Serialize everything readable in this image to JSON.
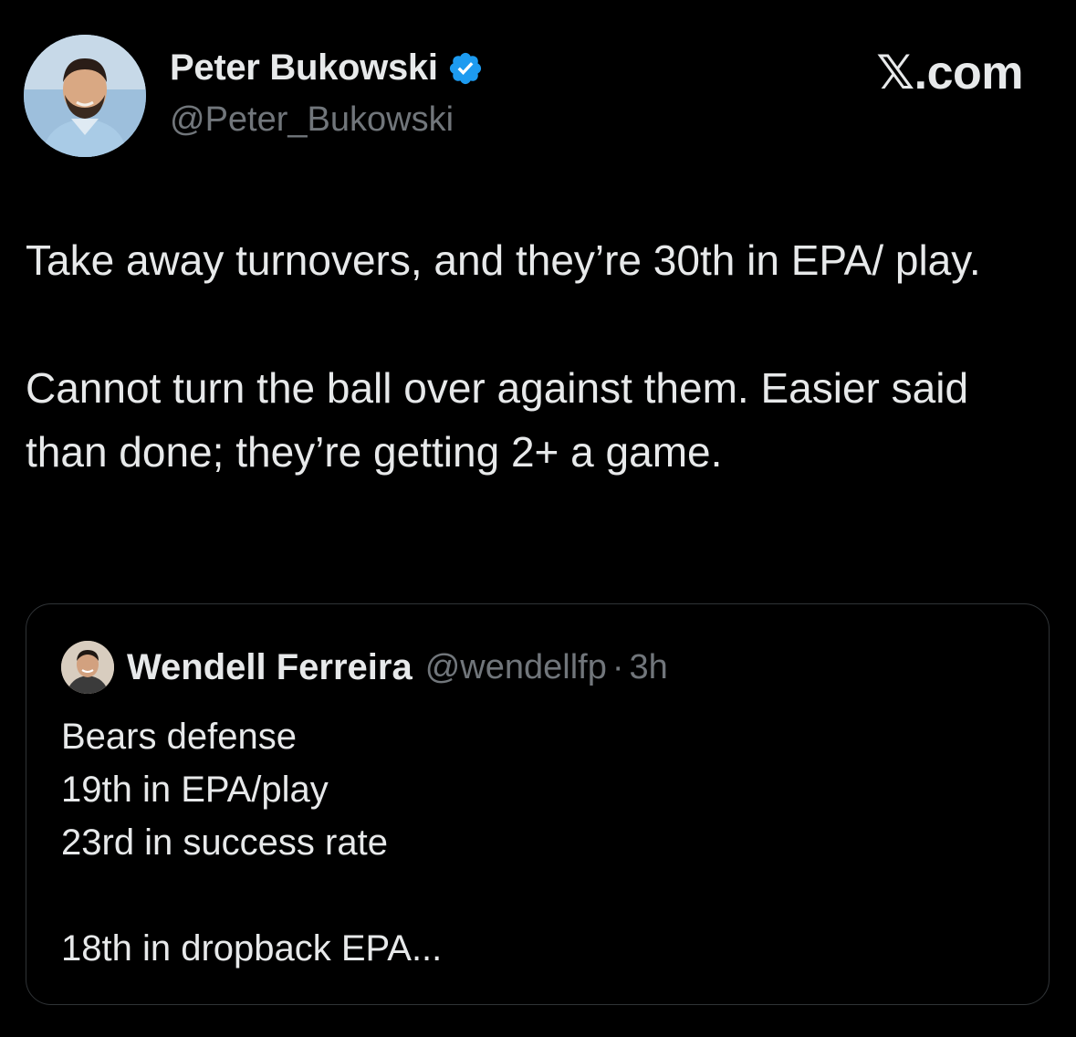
{
  "author": {
    "display_name": "Peter Bukowski",
    "handle": "@Peter_Bukowski",
    "verified_icon": "verified-badge-icon",
    "verified_color": "#1d9bf0"
  },
  "brand": "𝕏.com",
  "tweet": {
    "paragraphs": [
      "Take away turnovers, and they’re 30th in EPA/ play.",
      "Cannot turn the ball over against them. Easier said than done; they’re getting 2+ a game."
    ]
  },
  "quote": {
    "display_name": "Wendell Ferreira",
    "handle": "@wendellfp",
    "separator": "·",
    "time": "3h",
    "lines": [
      "Bears defense",
      "19th in EPA/play",
      "23rd in success rate",
      "",
      "18th in dropback EPA..."
    ]
  },
  "colors": {
    "background": "#000000",
    "text_primary": "#e7e9ea",
    "text_secondary": "#71767b",
    "card_border": "#2f3336"
  }
}
